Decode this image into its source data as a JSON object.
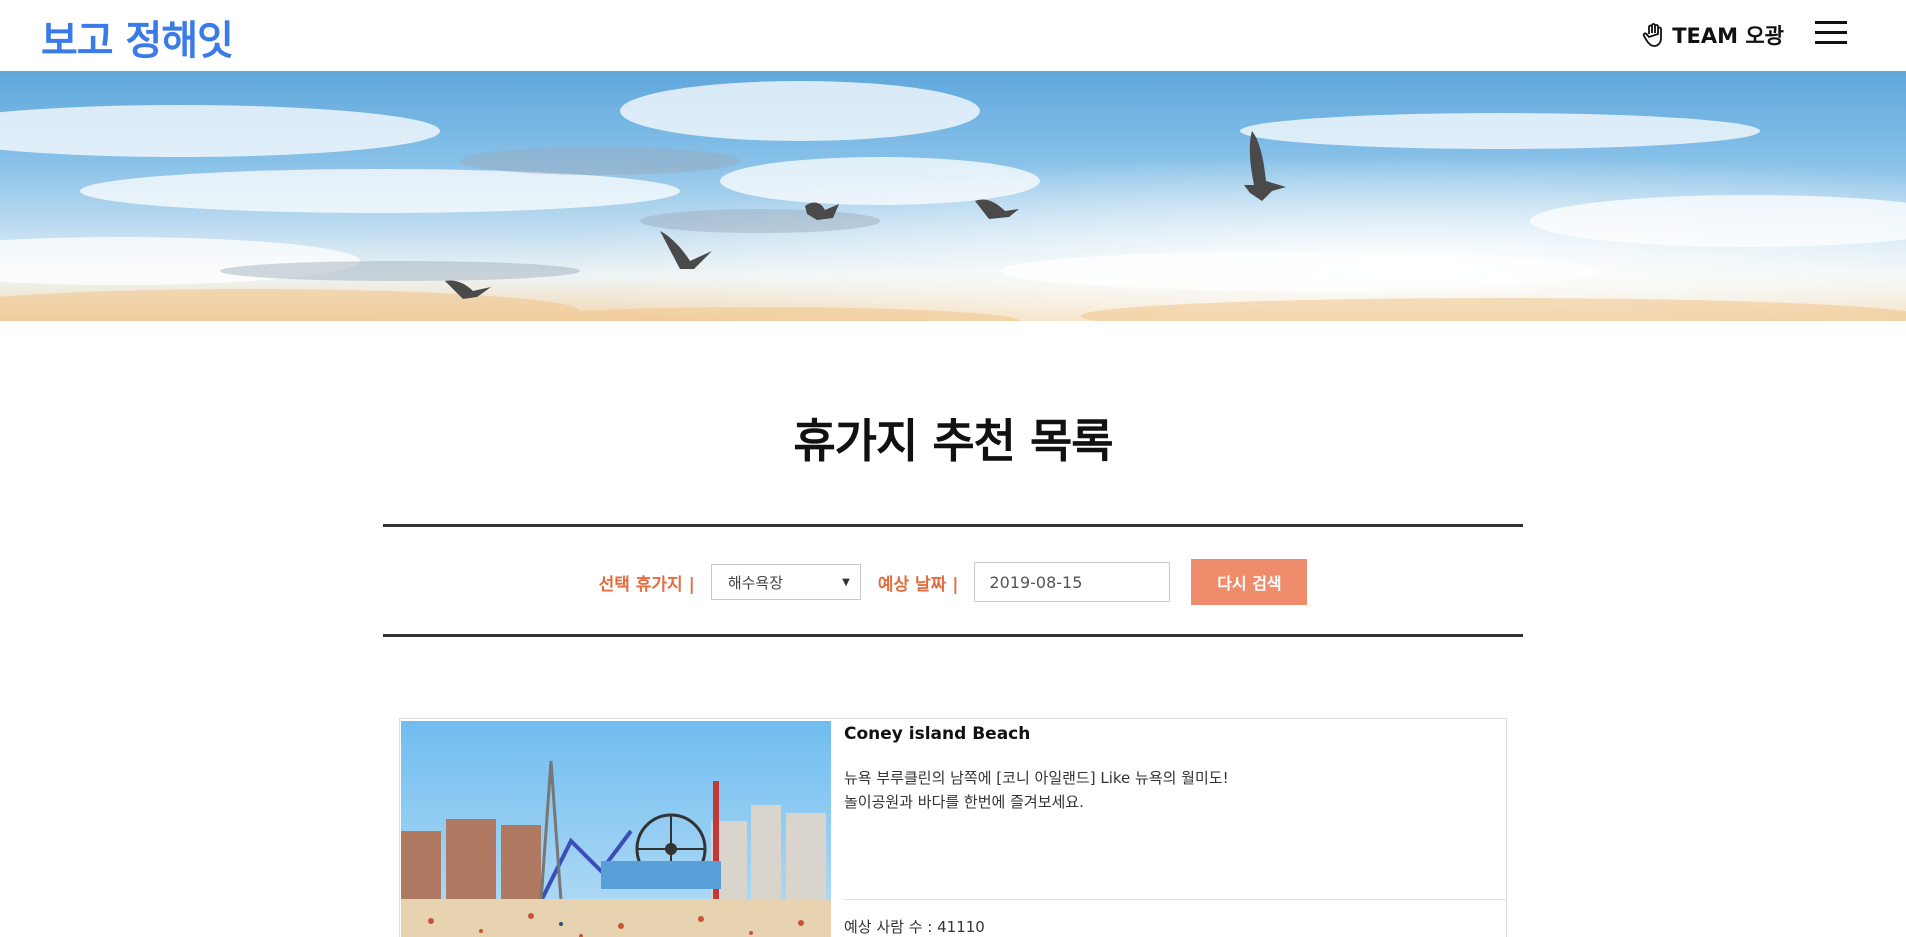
{
  "header": {
    "logo": "보고 정해잇",
    "team": "TEAM 오광"
  },
  "page": {
    "title": "휴가지 추천 목록"
  },
  "search": {
    "destination_label": "선택 휴가지 |",
    "destination_value": "해수욕장",
    "date_label": "예상 날짜 |",
    "date_value": "2019-08-15",
    "button_label": "다시 검색"
  },
  "results": [
    {
      "name": "Coney island Beach",
      "desc_line1": "뉴욕 부루클린의 남쪽에 [코니 아일랜드] Like 뉴욕의 월미도!",
      "desc_line2": "놀이공원과 바다를 한번에 즐겨보세요.",
      "meta": "예상 사람 수 : 41110"
    }
  ],
  "colors": {
    "logo": "#3b7be8",
    "accent_label": "#e36d3f",
    "button": "#ee8c6b"
  }
}
